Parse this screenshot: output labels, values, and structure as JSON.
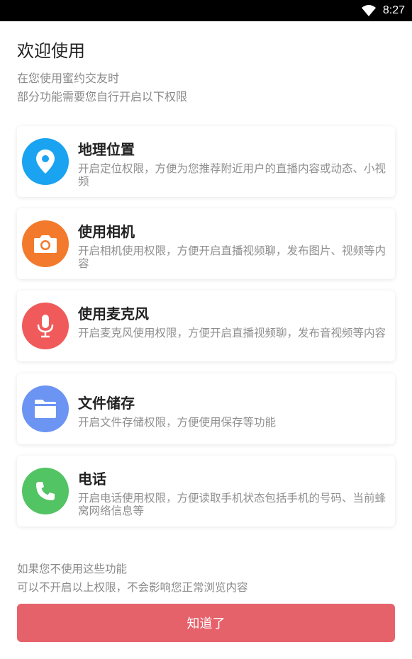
{
  "status_bar": {
    "time": "8:27",
    "wifi_icon": "wifi-icon"
  },
  "header": {
    "title": "欢迎使用",
    "subtitle_line1": "在您使用蜜约交友时",
    "subtitle_line2": "部分功能需要您自行开启以下权限"
  },
  "permissions": [
    {
      "title": "地理位置",
      "desc": "开启定位权限，方便为您推荐附近用户的直播内容或动态、小视频",
      "icon": "location-pin-icon",
      "color": "#1aa3f0"
    },
    {
      "title": "使用相机",
      "desc": "开启相机使用权限，方便开启直播视频聊，发布图片、视频等内容",
      "icon": "camera-icon",
      "color": "#f37a2c"
    },
    {
      "title": "使用麦克风",
      "desc": "开启麦克风使用权限，方便开启直播视频聊，发布音视频等内容",
      "icon": "microphone-icon",
      "color": "#f05a5a"
    },
    {
      "title": "文件储存",
      "desc": "开启文件存储权限，方便使用保存等功能",
      "icon": "folder-icon",
      "color": "#6b94f3"
    },
    {
      "title": "电话",
      "desc": "开启电话使用权限，方便读取手机状态包括手机的号码、当前蜂窝网络信息等",
      "icon": "phone-icon",
      "color": "#53c463"
    }
  ],
  "footer": {
    "note_line1": "如果您不使用这些功能",
    "note_line2": "可以不开启以上权限，不会影响您正常浏览内容",
    "button_label": "知道了",
    "button_color": "#e6626b"
  }
}
